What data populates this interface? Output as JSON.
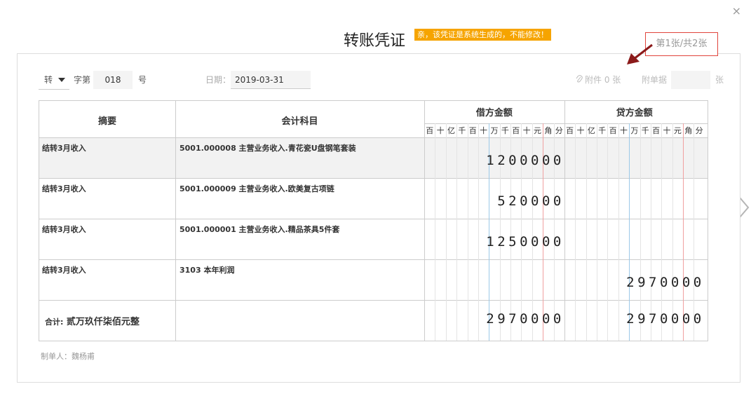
{
  "modal": {
    "title": "转账凭证",
    "notice": "亲，该凭证是系统生成的，不能修改！",
    "page_indicator": "第1张/共2张",
    "close_icon": "×"
  },
  "form": {
    "voucher_type": "转",
    "zi_label": "字第",
    "voucher_number": "018",
    "hao_label": "号",
    "date_label": "日期：",
    "date_value": "2019-03-31",
    "attachments": "附件 0 张",
    "attach_label": "附单据",
    "attach_value": "",
    "zhang_label": "张"
  },
  "table": {
    "headers": {
      "summary": "摘要",
      "account": "会计科目",
      "debit": "借方金额",
      "credit": "贷方金额"
    },
    "digit_units": [
      "百",
      "十",
      "亿",
      "千",
      "百",
      "十",
      "万",
      "千",
      "百",
      "十",
      "元",
      "角",
      "分"
    ],
    "rows": [
      {
        "summary": "结转3月收入",
        "account": "5001.000008 主营业务收入.青花瓷U盘钢笔套装",
        "debit": "1200000",
        "credit": ""
      },
      {
        "summary": "结转3月收入",
        "account": "5001.000009 主营业务收入.欧美复古项链",
        "debit": "520000",
        "credit": ""
      },
      {
        "summary": "结转3月收入",
        "account": "5001.000001 主营业务收入.精品茶具5件套",
        "debit": "1250000",
        "credit": ""
      },
      {
        "summary": "结转3月收入",
        "account": "3103 本年利润",
        "debit": "",
        "credit": "2970000"
      }
    ],
    "total": {
      "label": "合计:",
      "amount_words": "贰万玖仟柒佰元整",
      "debit": "2970000",
      "credit": "2970000"
    }
  },
  "footer": {
    "maker": "制单人：魏杨甫"
  },
  "colors": {
    "notice_bg": "#f6a400",
    "indicator_border": "#e0443c",
    "arrow": "#8b1a1a",
    "wan_line": "#9cc9e8",
    "yuan_line": "#f0a0a0"
  }
}
